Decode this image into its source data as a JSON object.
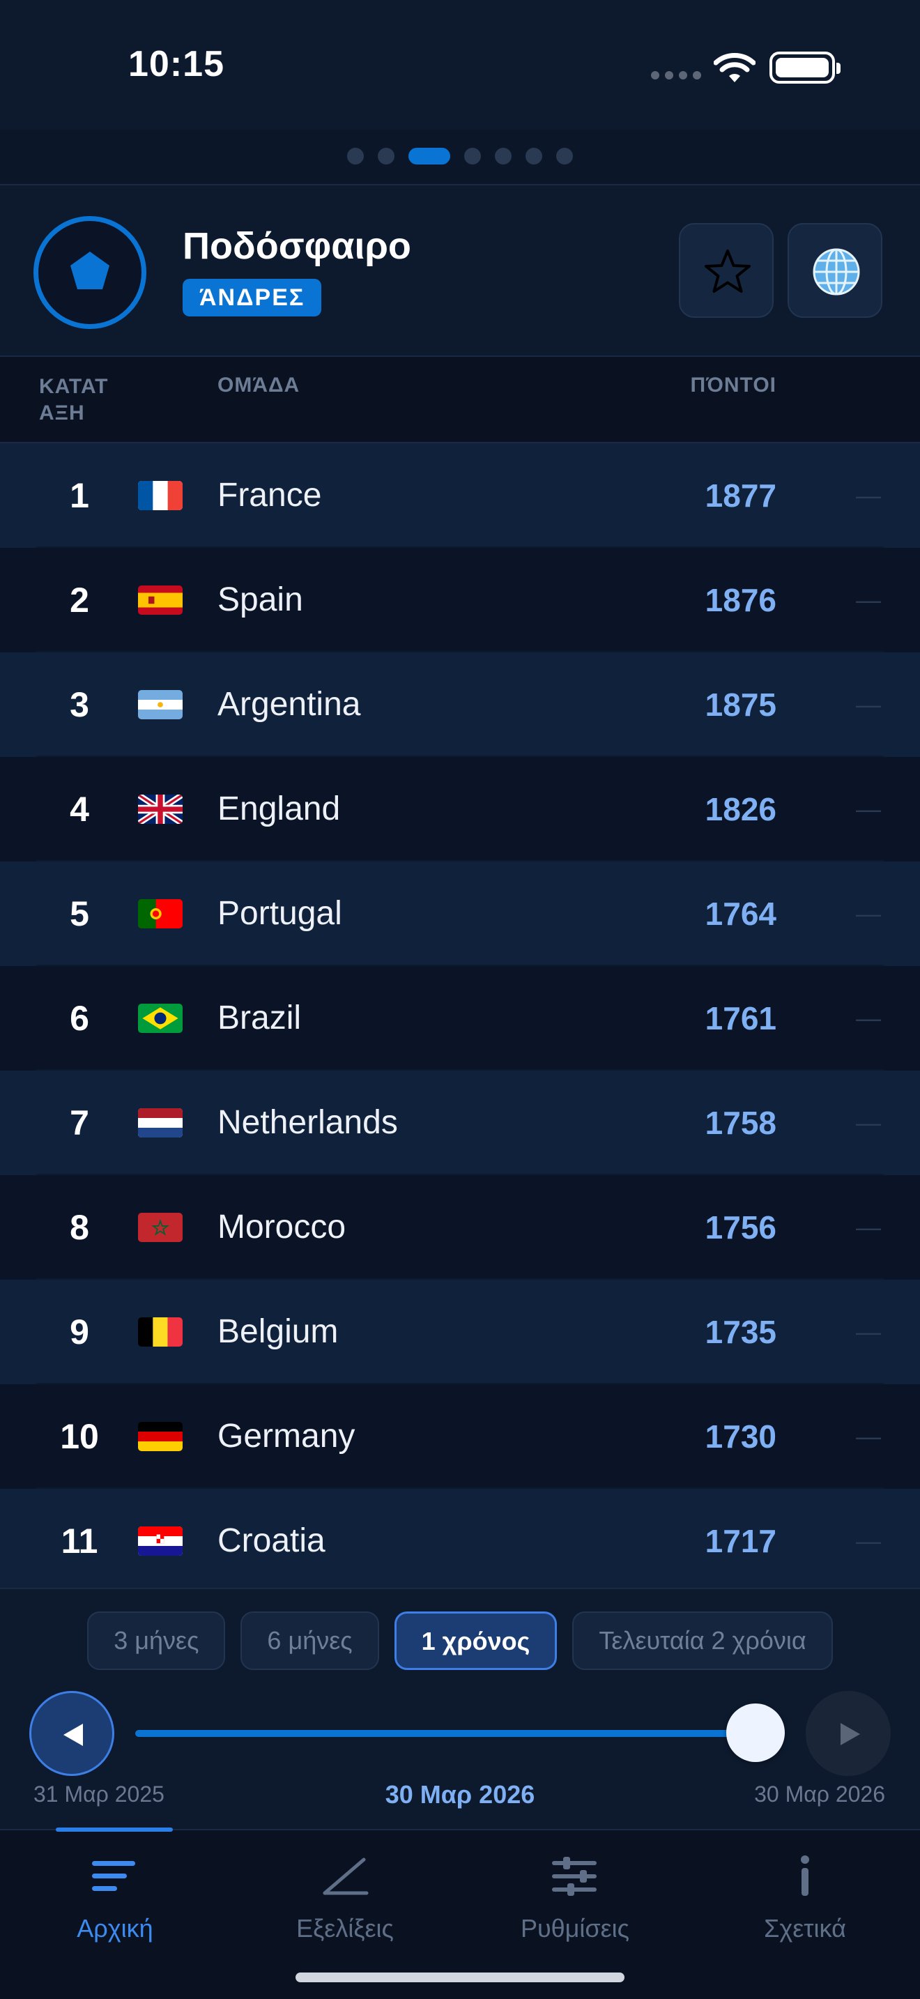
{
  "status_bar": {
    "time": "10:15"
  },
  "pager": {
    "count": 7,
    "active_index": 2
  },
  "header": {
    "sport_title": "Ποδόσφαιρο",
    "gender_badge": "ΆΝΔΡΕΣ",
    "sport_icon": "soccer-ball-pentagon-icon",
    "favorite_icon": "star-icon",
    "region_icon": "globe-icon"
  },
  "table": {
    "columns": {
      "rank": "ΚΑΤΑΤ ΑΞΗ",
      "team": "ΟΜΆΔΑ",
      "points": "ΠΌΝΤΟΙ"
    },
    "rows": [
      {
        "rank": "1",
        "team": "France",
        "points": "1877",
        "trend": "—",
        "flag": "france"
      },
      {
        "rank": "2",
        "team": "Spain",
        "points": "1876",
        "trend": "—",
        "flag": "spain"
      },
      {
        "rank": "3",
        "team": "Argentina",
        "points": "1875",
        "trend": "—",
        "flag": "argentina"
      },
      {
        "rank": "4",
        "team": "England",
        "points": "1826",
        "trend": "—",
        "flag": "uk"
      },
      {
        "rank": "5",
        "team": "Portugal",
        "points": "1764",
        "trend": "—",
        "flag": "portugal"
      },
      {
        "rank": "6",
        "team": "Brazil",
        "points": "1761",
        "trend": "—",
        "flag": "brazil"
      },
      {
        "rank": "7",
        "team": "Netherlands",
        "points": "1758",
        "trend": "—",
        "flag": "netherlands"
      },
      {
        "rank": "8",
        "team": "Morocco",
        "points": "1756",
        "trend": "—",
        "flag": "morocco"
      },
      {
        "rank": "9",
        "team": "Belgium",
        "points": "1735",
        "trend": "—",
        "flag": "belgium"
      },
      {
        "rank": "10",
        "team": "Germany",
        "points": "1730",
        "trend": "—",
        "flag": "germany"
      },
      {
        "rank": "11",
        "team": "Croatia",
        "points": "1717",
        "trend": "—",
        "flag": "croatia"
      }
    ]
  },
  "period": {
    "options": [
      "3 μήνες",
      "6 μήνες",
      "1 χρόνος",
      "Τελευταία 2 χρόνια"
    ],
    "selected_index": 2,
    "start_date": "31 Μαρ 2025",
    "current_date": "30 Μαρ 2026",
    "end_date": "30 Μαρ 2026",
    "slider_fraction": 1.0,
    "play_icon": "play-reverse-icon",
    "forward_icon": "play-forward-icon"
  },
  "tabs": [
    {
      "label": "Αρχική",
      "icon": "list-lines-icon",
      "active": true
    },
    {
      "label": "Εξελίξεις",
      "icon": "trend-line-icon",
      "active": false
    },
    {
      "label": "Ρυθμίσεις",
      "icon": "sliders-icon",
      "active": false
    },
    {
      "label": "Σχετικά",
      "icon": "info-icon",
      "active": false
    }
  ],
  "colors": {
    "accent": "#0a74d4",
    "points": "#7fb0f4",
    "background": "#0a1426",
    "row_alt": "#0f213b"
  }
}
